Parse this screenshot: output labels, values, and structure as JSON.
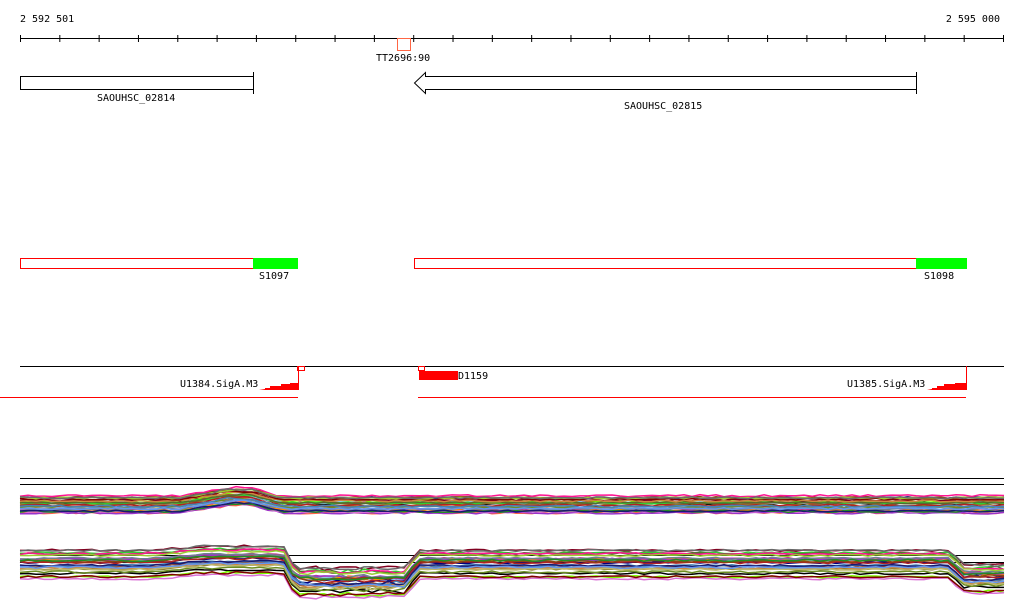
{
  "ruler": {
    "start_label": "2 592 501",
    "end_label": "2 595 000",
    "tick_count": 26
  },
  "terminator": {
    "label": "TT2696:90",
    "color": "#ff6644"
  },
  "genes": [
    {
      "label": "SAOUHSC_02814",
      "strand": "+"
    },
    {
      "label": "SAOUHSC_02815",
      "strand": "-"
    }
  ],
  "segments": [
    {
      "label": "S1097",
      "color": "#ff0000",
      "accent": "#00ff00"
    },
    {
      "label": "S1098",
      "color": "#ff0000",
      "accent": "#00ff00"
    }
  ],
  "promoters": [
    {
      "label": "U1384.SigA.M3"
    },
    {
      "label": "U1385.SigA.M3"
    },
    {
      "label": "D1159"
    }
  ],
  "expression_colors": [
    "#000000",
    "#8b7d2b",
    "#c0398f",
    "#ff6347",
    "#d2691e",
    "#7cfc00",
    "#9ab0d0",
    "#800020",
    "#6b8e23",
    "#87cefa",
    "#000080",
    "#a0522d",
    "#ff8c00",
    "#9932cc",
    "#32cd32",
    "#708090",
    "#b22222",
    "#556b2f",
    "#da70d6",
    "#4682b4",
    "#8b4513",
    "#ff1493",
    "#228b22",
    "#cd853f",
    "#191970",
    "#bdb76b",
    "#6495ed",
    "#800000",
    "#9acd32",
    "#696969"
  ]
}
